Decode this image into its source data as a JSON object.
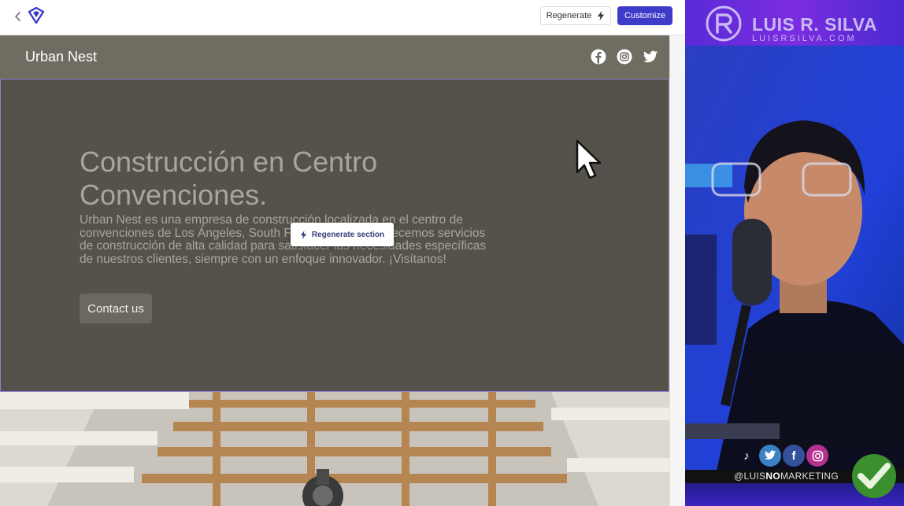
{
  "topbar": {
    "regenerate_label": "Regenerate",
    "customize_label": "Customize"
  },
  "site": {
    "brand": "Urban Nest",
    "socials": [
      "facebook-icon",
      "instagram-icon",
      "twitter-icon"
    ]
  },
  "hero": {
    "title": "Construcción en Centro Convenciones.",
    "description": "Urban Nest es una empresa de construcción localizada en el centro de convenciones de Los Ángeles, South Figueroa Street. Ofrecemos servicios de construcción de alta calidad para satisfacer las necesidades específicas de nuestros clientes, siempre con un enfoque innovador. ¡Visítanos!",
    "contact_label": "Contact us",
    "regen_section_label": "Regenerate section"
  },
  "streamer": {
    "banner_name": "LUIS R. SILVA",
    "banner_url": "LUISRSILVA.COM",
    "handle_pre": "@LUIS",
    "handle_bold": "NO",
    "handle_post": "MARKETING",
    "social_icons": [
      "tiktok-icon",
      "twitter-icon",
      "facebook-icon",
      "instagram-icon"
    ]
  },
  "colors": {
    "accent": "#3f3bc9",
    "hero_bg": "#54524a",
    "header_bg": "#6f6d61",
    "banner": "#7b2de0"
  }
}
